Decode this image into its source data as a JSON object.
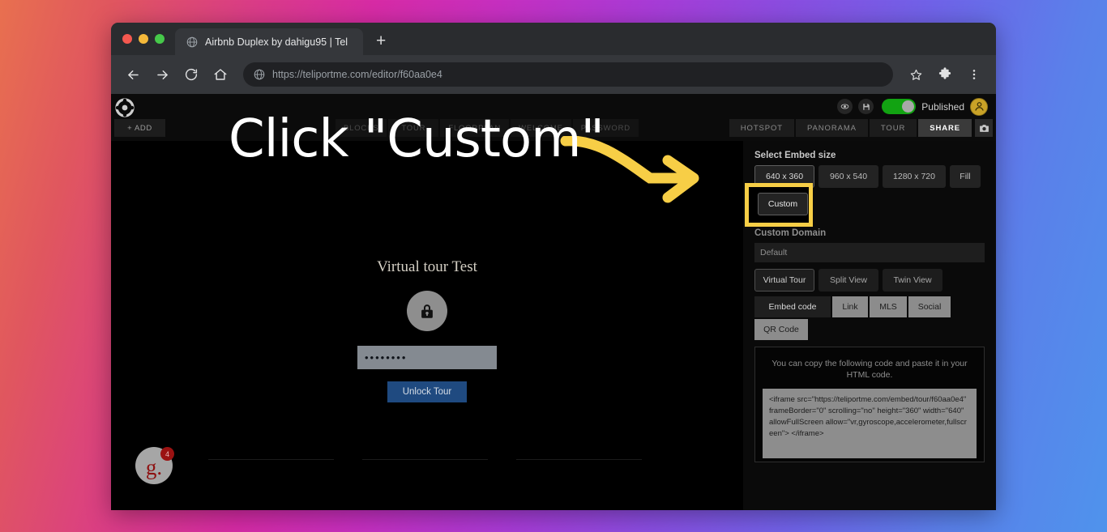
{
  "browser": {
    "window_controls": [
      "close",
      "minimize",
      "maximize"
    ],
    "tab_title": "Airbnb Duplex by dahigu95 | Tel",
    "tab_favicon": "globe-icon",
    "new_tab_label": "+",
    "nav": {
      "back": "back-arrow-icon",
      "forward": "forward-arrow-icon",
      "reload": "reload-icon",
      "home": "home-icon"
    },
    "url": "https://teliportme.com/editor/f60aa0e4",
    "url_icon": "globe-icon",
    "omni_actions": [
      "bookmark-star-icon",
      "extensions-puzzle-icon",
      "chrome-menu-icon"
    ]
  },
  "app": {
    "logo": "teliportme-logo",
    "add_button": "+ ADD",
    "left_tabs": [
      "BLOCKS",
      "TOUR",
      "FLOORPLAN",
      "WELCOME",
      "PASSWORD"
    ],
    "right_tabs": [
      "HOTSPOT",
      "PANORAMA",
      "TOUR",
      "SHARE"
    ],
    "active_right_tab": "SHARE",
    "status": {
      "preview_icon": "eye-icon",
      "save_icon": "save-icon",
      "toggle_state": "on",
      "published_label": "Published",
      "toggle_color": "#12a312"
    },
    "avatar": "user-avatar",
    "camera_button": "camera-icon"
  },
  "stage": {
    "tour_title": "Virtual tour Test",
    "lock_icon": "lock-icon",
    "password_value": "••••••••",
    "unlock_button": "Unlock Tour",
    "grammarly": {
      "letter": "g.",
      "badge_count": "4"
    }
  },
  "panel": {
    "embed_size_label": "Select Embed size",
    "sizes": [
      {
        "label": "640 x 360",
        "selected": true
      },
      {
        "label": "960 x 540",
        "selected": false
      },
      {
        "label": "1280 x 720",
        "selected": false
      },
      {
        "label": "Fill",
        "selected": false
      }
    ],
    "custom_button": "Custom",
    "custom_domain_label": "Custom Domain",
    "custom_domain_value": "Default",
    "views": [
      {
        "label": "Virtual Tour",
        "selected": true
      },
      {
        "label": "Split View",
        "selected": false
      },
      {
        "label": "Twin View",
        "selected": false
      }
    ],
    "code_tabs": [
      {
        "label": "Embed code",
        "active": true
      },
      {
        "label": "Link",
        "active": false
      },
      {
        "label": "MLS",
        "active": false
      },
      {
        "label": "Social",
        "active": false
      },
      {
        "label": "QR Code",
        "active": false
      }
    ],
    "code_hint": "You can copy the following code and paste it in your HTML code.",
    "embed_code": "<iframe src=\"https://teliportme.com/embed/tour/f60aa0e4\" frameBorder=\"0\" scrolling=\"no\" height=\"360\" width=\"640\" allowFullScreen allow=\"vr,gyroscope,accelerometer,fullscreen\"> </iframe>"
  },
  "annotation": {
    "text": "Click \"Custom\"",
    "arrow": "curved-arrow-right",
    "highlight_color": "#f7ce46"
  }
}
